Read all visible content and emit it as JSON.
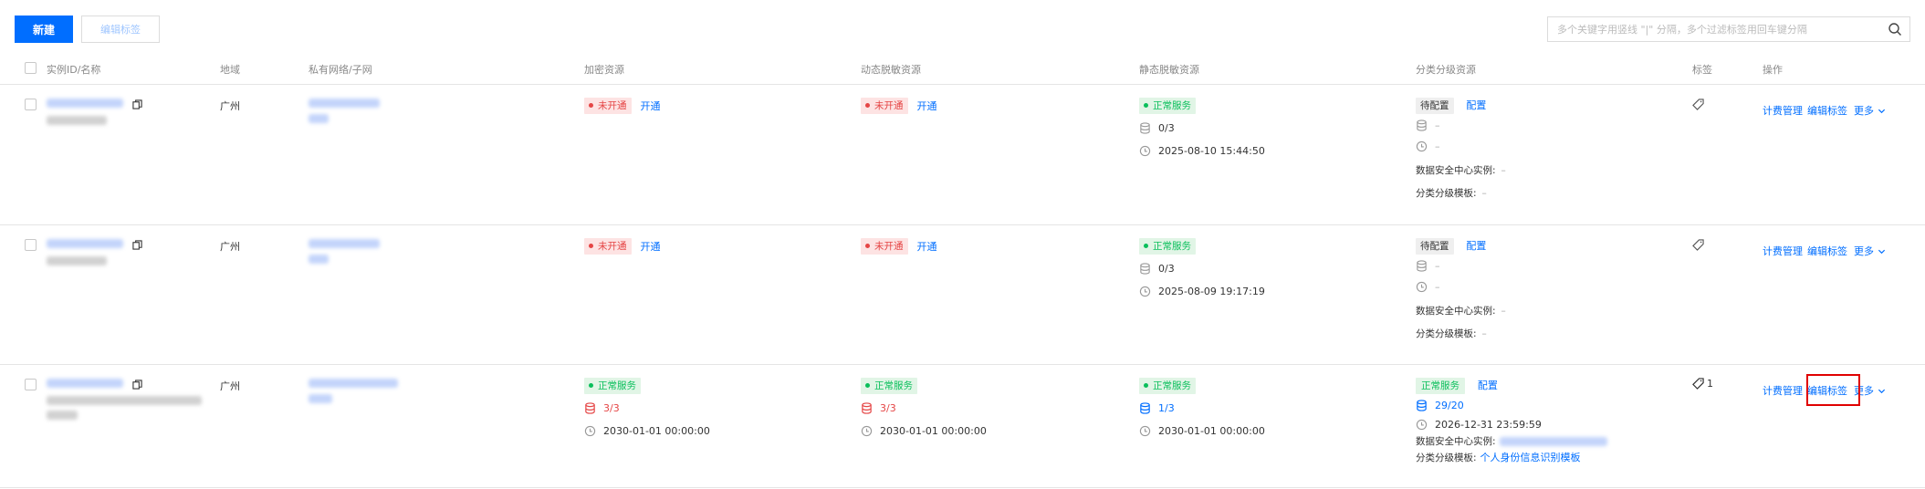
{
  "toolbar": {
    "new_label": "新建",
    "edit_tags_label": "编辑标签",
    "search_placeholder": "多个关键字用竖线 \"|\" 分隔，多个过滤标签用回车键分隔"
  },
  "columns": {
    "instance": "实例ID/名称",
    "region": "地域",
    "vpc": "私有网络/子网",
    "encrypt": "加密资源",
    "dynamic_mask": "动态脱敏资源",
    "static_mask": "静态脱敏资源",
    "classify": "分类分级资源",
    "tags": "标签",
    "actions": "操作"
  },
  "rows": [
    {
      "region": "广州",
      "encrypt": {
        "status": "未开通",
        "action": "开通"
      },
      "dynamic": {
        "status": "未开通",
        "action": "开通"
      },
      "static": {
        "status": "正常服务",
        "count": "0/3",
        "time": "2025-08-10 15:44:50"
      },
      "classify": {
        "status": "待配置",
        "action": "配置",
        "count": "–",
        "time": "–",
        "dsc_label": "数据安全中心实例:",
        "dsc_value": "–",
        "template_label": "分类分级模板:",
        "template_value": "–"
      },
      "tag_count": "",
      "actions": {
        "billing": "计费管理",
        "edit_tags": "编辑标签",
        "more": "更多"
      }
    },
    {
      "region": "广州",
      "encrypt": {
        "status": "未开通",
        "action": "开通"
      },
      "dynamic": {
        "status": "未开通",
        "action": "开通"
      },
      "static": {
        "status": "正常服务",
        "count": "0/3",
        "time": "2025-08-09 19:17:19"
      },
      "classify": {
        "status": "待配置",
        "action": "配置",
        "count": "–",
        "time": "–",
        "dsc_label": "数据安全中心实例:",
        "dsc_value": "–",
        "template_label": "分类分级模板:",
        "template_value": "–"
      },
      "tag_count": "",
      "actions": {
        "billing": "计费管理",
        "edit_tags": "编辑标签",
        "more": "更多"
      }
    },
    {
      "region": "广州",
      "encrypt": {
        "status": "正常服务",
        "count": "3/3",
        "time": "2030-01-01 00:00:00"
      },
      "dynamic": {
        "status": "正常服务",
        "count": "3/3",
        "time": "2030-01-01 00:00:00"
      },
      "static": {
        "status": "正常服务",
        "count": "1/3",
        "time": "2030-01-01 00:00:00"
      },
      "classify": {
        "status": "正常服务",
        "action": "配置",
        "count": "29/20",
        "time": "2026-12-31 23:59:59",
        "dsc_label": "数据安全中心实例:",
        "dsc_value": "",
        "template_label": "分类分级模板:",
        "template_value": "个人身份信息识别模板"
      },
      "tag_count": "1",
      "actions": {
        "billing": "计费管理",
        "edit_tags": "编辑标签",
        "more": "更多"
      }
    }
  ],
  "colors": {
    "primary": "#006eff",
    "danger": "#e54545",
    "success": "#0abf5b",
    "highlight": "#e00000"
  }
}
